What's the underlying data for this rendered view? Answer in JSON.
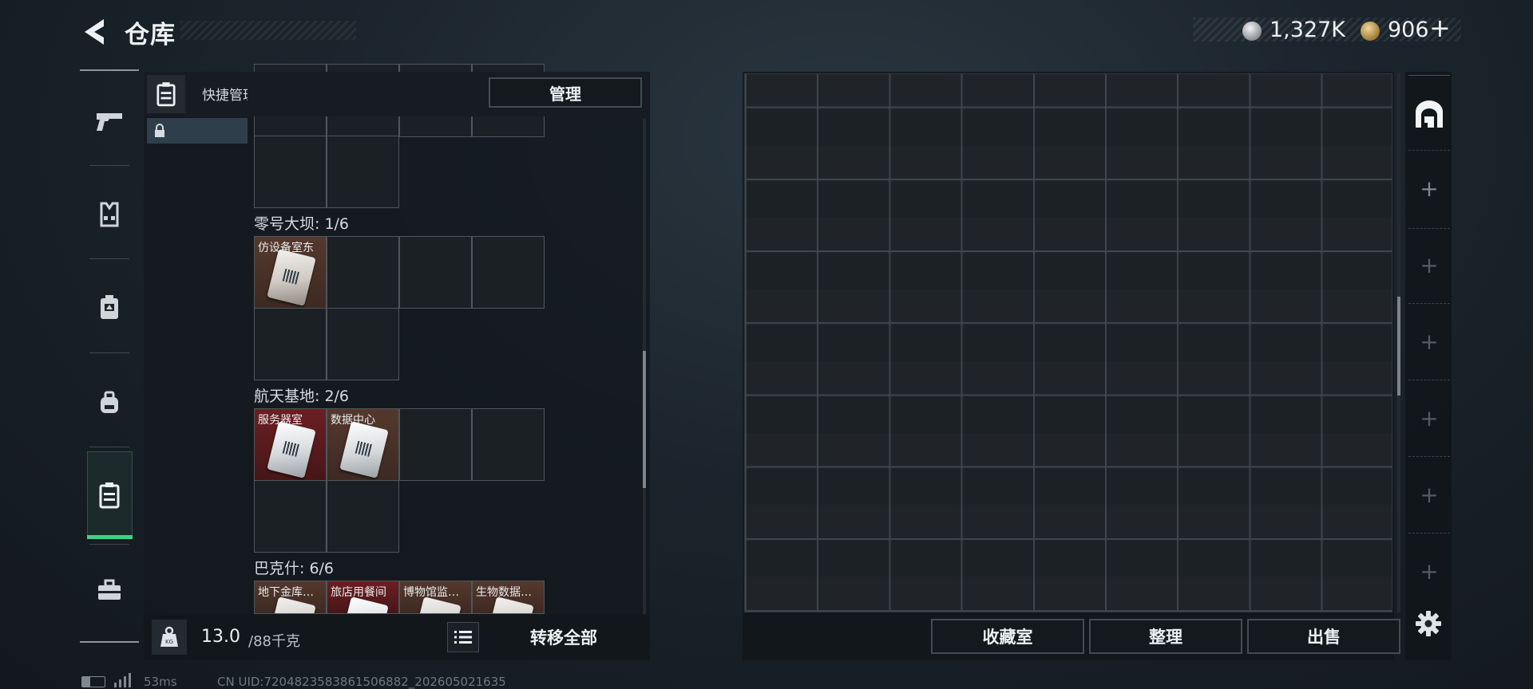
{
  "header": {
    "title": "仓库",
    "currency_silver": "1,327K",
    "currency_gold": "906",
    "add_symbol": "+"
  },
  "sidebar": {
    "items": [
      {
        "icon": "pistol-icon"
      },
      {
        "icon": "vest-icon"
      },
      {
        "icon": "chest-rig-icon"
      },
      {
        "icon": "backpack-icon"
      },
      {
        "icon": "keycard-icon",
        "active": true
      },
      {
        "icon": "toolbox-icon"
      }
    ]
  },
  "keycard_panel": {
    "header_label": "快捷管理门卡",
    "manage_label": "管理",
    "sections": [
      {
        "title": "零号大坝: 1/6",
        "cards": [
          {
            "label": "仿设备室东",
            "rarity": "brown"
          }
        ]
      },
      {
        "title": "航天基地: 2/6",
        "cards": [
          {
            "label": "服务器室",
            "rarity": "red"
          },
          {
            "label": "数据中心",
            "rarity": "brown"
          }
        ]
      },
      {
        "title": "巴克什: 6/6",
        "cards": [
          {
            "label": "地下金库…",
            "rarity": "brown"
          },
          {
            "label": "旅店用餐间",
            "rarity": "red"
          },
          {
            "label": "博物馆监…",
            "rarity": "brown"
          },
          {
            "label": "生物数据…",
            "rarity": "brown"
          }
        ]
      }
    ],
    "footer": {
      "weight_current": "13.0",
      "weight_max": "/88千克",
      "transfer_all_label": "转移全部"
    }
  },
  "stash_panel": {
    "buttons": {
      "collection": "收藏室",
      "sort": "整理",
      "sell": "出售"
    }
  },
  "status_bar": {
    "ping": "53ms",
    "uid": "CN UID:7204823583861506882_202605021635"
  },
  "colors": {
    "accent_green": "#3fd186",
    "rarity_red": "#6b1f22",
    "rarity_brown": "#55382d"
  }
}
